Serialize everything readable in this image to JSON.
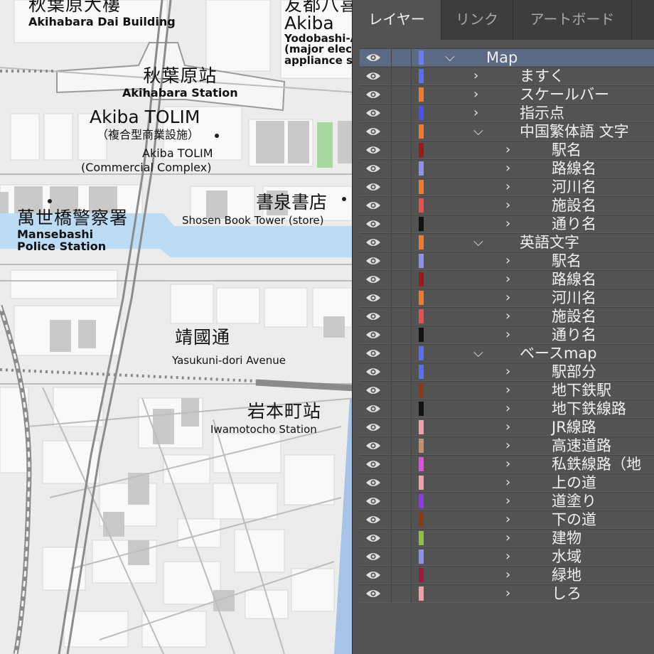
{
  "map": {
    "labels": {
      "akihabara_dai_ja": "秋葉原大樓",
      "akihabara_dai_en": "Akihabara Dai Building",
      "yodobashi_ja": "友都八喜",
      "yodobashi_akiba": "Akiba",
      "yodobashi_en1": "Yodobashi-A",
      "yodobashi_en2": "(major elect",
      "yodobashi_en3": "appliance st",
      "akihabara_station_ja": "秋葉原站",
      "akihabara_station_en": "Akihabara Station",
      "tolim_title": "Akiba TOLIM",
      "tolim_ja": "（複合型商業設施）",
      "tolim_en1": "Akiba TOLIM",
      "tolim_en2": "(Commercial Complex)",
      "police_ja": "萬世橋警察署",
      "police_en1": "Mansebashi",
      "police_en2": "Police Station",
      "shosen_ja": "書泉書店",
      "shosen_en": "Shosen Book Tower (store)",
      "yasukuni_ja": "靖國通",
      "yasukuni_en": "Yasukuni-dori Avenue",
      "iwamotocho_ja": "岩本町站",
      "iwamotocho_en": "Iwamotocho Station"
    }
  },
  "panel": {
    "tabs": [
      {
        "label": "レイヤー",
        "active": true
      },
      {
        "label": "リンク",
        "active": false
      },
      {
        "label": "アートボード",
        "active": false
      }
    ],
    "layers": [
      {
        "name": "Map",
        "level": 0,
        "expanded": true,
        "color": "#6b7cf5",
        "selected": true
      },
      {
        "name": "ますく",
        "level": 1,
        "expanded": false,
        "color": "#5b6ef0"
      },
      {
        "name": "スケールバー",
        "level": 1,
        "expanded": false,
        "color": "#f07a2e"
      },
      {
        "name": "指示点",
        "level": 1,
        "expanded": false,
        "color": "#5050ef"
      },
      {
        "name": "中国繁体語 文字",
        "level": 1,
        "expanded": true,
        "color": "#f07a2e"
      },
      {
        "name": "駅名",
        "level": 2,
        "expanded": false,
        "color": "#9c1a1a"
      },
      {
        "name": "路線名",
        "level": 2,
        "expanded": false,
        "color": "#9090f0"
      },
      {
        "name": "河川名",
        "level": 2,
        "expanded": false,
        "color": "#f07a2e"
      },
      {
        "name": "施設名",
        "level": 2,
        "expanded": false,
        "color": "#e85050"
      },
      {
        "name": "通り名",
        "level": 2,
        "expanded": false,
        "color": "#111111"
      },
      {
        "name": "英語文字",
        "level": 1,
        "expanded": true,
        "color": "#f07a2e"
      },
      {
        "name": "駅名",
        "level": 2,
        "expanded": false,
        "color": "#9090f0"
      },
      {
        "name": "路線名",
        "level": 2,
        "expanded": false,
        "color": "#9c1a1a"
      },
      {
        "name": "河川名",
        "level": 2,
        "expanded": false,
        "color": "#f07a2e"
      },
      {
        "name": "施設名",
        "level": 2,
        "expanded": false,
        "color": "#e85050"
      },
      {
        "name": "通り名",
        "level": 2,
        "expanded": false,
        "color": "#111111"
      },
      {
        "name": "ベースmap",
        "level": 1,
        "expanded": true,
        "color": "#5b6ef0"
      },
      {
        "name": "駅部分",
        "level": 2,
        "expanded": false,
        "color": "#5b6ef0"
      },
      {
        "name": "地下鉄駅",
        "level": 2,
        "expanded": false,
        "color": "#8a3a1a"
      },
      {
        "name": "地下鉄線路",
        "level": 2,
        "expanded": false,
        "color": "#111111"
      },
      {
        "name": "JR線路",
        "level": 2,
        "expanded": false,
        "color": "#f0a0a8"
      },
      {
        "name": "高速道路",
        "level": 2,
        "expanded": false,
        "color": "#c09070"
      },
      {
        "name": "私鉄線路（地",
        "level": 2,
        "expanded": false,
        "color": "#e050e0"
      },
      {
        "name": "上の道",
        "level": 2,
        "expanded": false,
        "color": "#f0a0a8"
      },
      {
        "name": "道塗り",
        "level": 2,
        "expanded": false,
        "color": "#8a3ae8"
      },
      {
        "name": "下の道",
        "level": 2,
        "expanded": false,
        "color": "#8a3a1a"
      },
      {
        "name": "建物",
        "level": 2,
        "expanded": false,
        "color": "#90c040"
      },
      {
        "name": "水域",
        "level": 2,
        "expanded": false,
        "color": "#9090f0"
      },
      {
        "name": "緑地",
        "level": 2,
        "expanded": false,
        "color": "#9c1a3a"
      },
      {
        "name": "しろ",
        "level": 2,
        "expanded": false,
        "color": "#f0a0a8"
      }
    ]
  }
}
